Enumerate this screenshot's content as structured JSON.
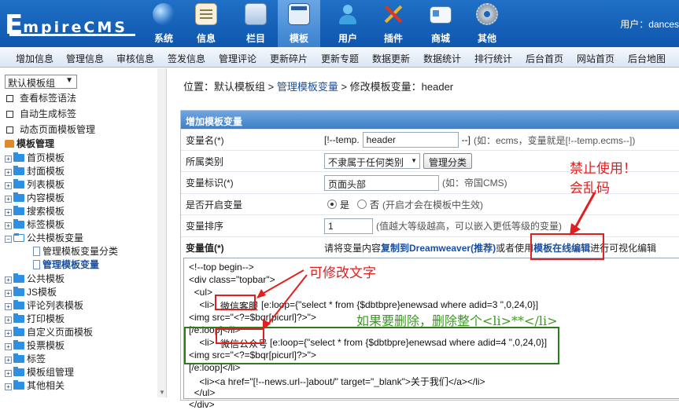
{
  "header": {
    "logo_initial": "E",
    "logo_rest": "mpireCMS",
    "nav": [
      {
        "label": "系统",
        "icon": "globe-icon"
      },
      {
        "label": "信息",
        "icon": "document-icon"
      },
      {
        "label": "栏目",
        "icon": "folder-icon"
      },
      {
        "label": "模板",
        "icon": "template-icon"
      },
      {
        "label": "用户",
        "icon": "user-icon"
      },
      {
        "label": "插件",
        "icon": "tools-icon"
      },
      {
        "label": "商城",
        "icon": "shop-card-icon"
      },
      {
        "label": "其他",
        "icon": "gear-icon"
      }
    ],
    "user": "用户：dances"
  },
  "menubar": [
    "增加信息",
    "管理信息",
    "审核信息",
    "签发信息",
    "管理评论",
    "更新碎片",
    "更新专题",
    "数据更新",
    "数据统计",
    "排行统计",
    "后台首页",
    "网站首页",
    "后台地图"
  ],
  "sidebar": {
    "group_select": "默认模板组",
    "links": [
      "查看标签语法",
      "自动生成标签",
      "动态页面模板管理"
    ],
    "root": "模板管理",
    "tree": [
      "首页模板",
      "封面模板",
      "列表模板",
      "内容模板",
      "搜索模板",
      "标签模板",
      "公共模板变量",
      "管理模板变量分类",
      "管理模板变量",
      "公共模板",
      "JS模板",
      "评论列表模板",
      "打印模板",
      "自定义页面模板",
      "投票模板",
      "标签",
      "模板组管理",
      "其他相关"
    ]
  },
  "breadcrumb": {
    "prefix": "位置：默认模板组 > ",
    "link": "管理模板变量",
    "suffix": " > 修改模板变量：header"
  },
  "form": {
    "title": "增加模板变量",
    "rows": {
      "name_label": "变量名(*)",
      "name_prefix": "[!--temp.",
      "name_value": "header",
      "name_suffix": "--]",
      "name_hint": "(如：ecms，变量就是[!--temp.ecms--])",
      "class_label": "所属类别",
      "class_value": "不隶属于任何类别",
      "class_button": "管理分类",
      "mark_label": "变量标识(*)",
      "mark_value": "页面头部",
      "mark_hint": "(如：帝国CMS)",
      "open_label": "是否开启变量",
      "open_yes": "是",
      "open_no": "否",
      "open_hint": "(开启才会在模板中生效)",
      "order_label": "变量排序",
      "order_value": "1",
      "order_hint": "(值越大等级越高，可以嵌入更低等级的变量)",
      "value_label": "变量值(*)",
      "value_text1": "请将变量内容",
      "value_text2": "复制到Dreamweaver(推荐)",
      "value_text3": "或者使用",
      "value_text4": "模板在线编辑",
      "value_text5": "进行可视化编辑"
    },
    "code": [
      "<!--top begin-->",
      "<div class=\"topbar\">",
      "  <ul>",
      "    <li>",
      "微信客服",
      "[e:loop={\"select * from {$dbtbpre}enewsad where adid=3 \",0,24,0}]",
      "<img src=\"<?=$bqr[picurl]?>\">",
      "[/e:loop]</li>",
      "    <li>",
      "微信公众号",
      "[e:loop={\"select * from {$dbtbpre}enewsad where adid=4 \",0,24,0}]",
      "<img src=\"<?=$bqr[picurl]?>\">",
      "[/e:loop]</li>",
      "    <li><a href=\"[!--news.url--]about/\" target=\"_blank\">关于我们</a></li>",
      "  </ul>",
      "</div>"
    ]
  },
  "annotations": {
    "forbid_line1": "禁止使用！",
    "forbid_line2": "会乱码",
    "editable": "可修改文字",
    "delete_hint": "如果要删除，删除整个<li>**</li>"
  },
  "colors": {
    "header_blue": "#1565c0",
    "annotation_red": "#e02020",
    "annotation_green": "#3a9a1f",
    "link_blue": "#1a4fa0"
  }
}
